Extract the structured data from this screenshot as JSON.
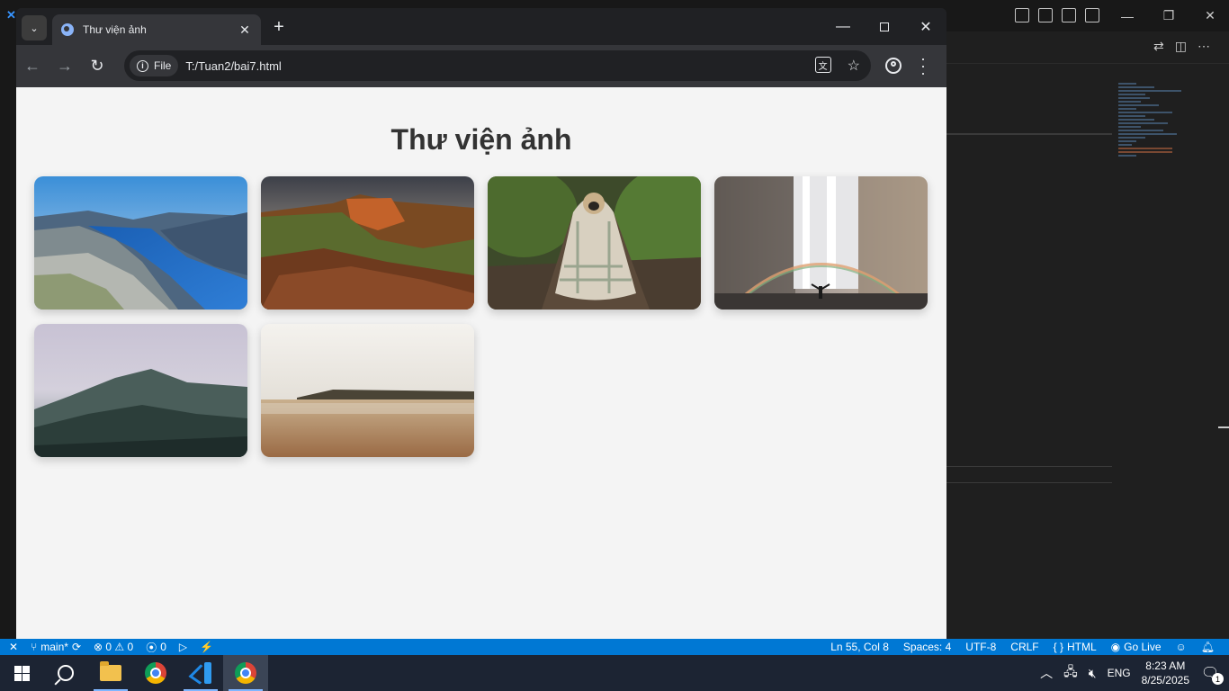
{
  "vscode": {
    "statusbar": {
      "branch": "main*",
      "problems": "⊗ 0 ⚠ 0",
      "ports": "0",
      "position": "Ln 55, Col 8",
      "spaces": "Spaces: 4",
      "encoding": "UTF-8",
      "eol": "CRLF",
      "language": "HTML",
      "golive": "Go Live"
    }
  },
  "browser": {
    "tab_title": "Thư viện ảnh",
    "site_chip": "File",
    "url": "T:/Tuan2/bai7.html"
  },
  "page": {
    "title": "Thư viện ảnh",
    "images": [
      {
        "name": "fjord-landscape"
      },
      {
        "name": "canyon-sunset"
      },
      {
        "name": "pug-in-blanket"
      },
      {
        "name": "waterfall-rainbow"
      },
      {
        "name": "misty-mountains"
      },
      {
        "name": "beach-shoreline"
      }
    ]
  },
  "taskbar": {
    "language": "ENG",
    "time": "8:23 AM",
    "date": "8/25/2025",
    "notification_count": "1"
  },
  "colors": {
    "status_bar": "#0078d4",
    "page_bg": "#f4f4f4",
    "title": "#333333"
  }
}
